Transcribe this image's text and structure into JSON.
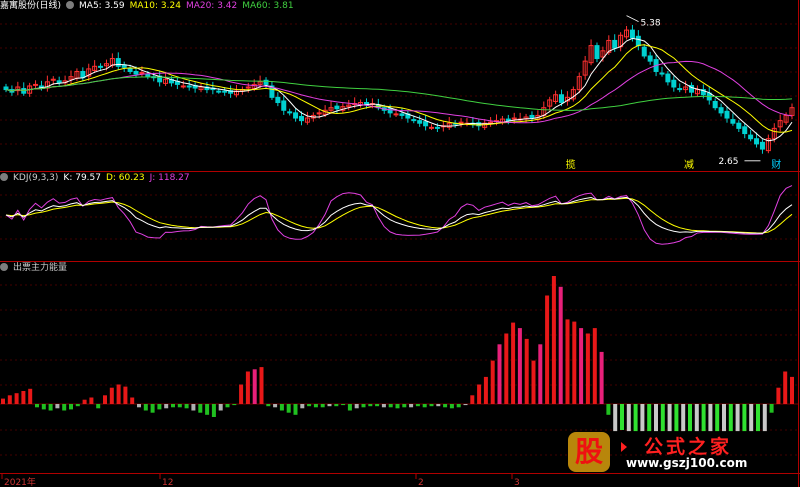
{
  "header_main": {
    "title": "嘉寓股份(日线)",
    "ma": [
      {
        "label": "MA5: 3.59",
        "color": "#ffffff"
      },
      {
        "label": "MA10: 3.24",
        "color": "#ffff00"
      },
      {
        "label": "MA20: 3.42",
        "color": "#e040e0"
      },
      {
        "label": "MA60: 3.81",
        "color": "#40d040"
      }
    ]
  },
  "header_kdj": {
    "title": "KDJ(9,3,3)",
    "items": [
      {
        "label": "K: 79.57",
        "color": "#ffffff"
      },
      {
        "label": "D: 60.23",
        "color": "#ffff00"
      },
      {
        "label": "J: 118.27",
        "color": "#e040e0"
      }
    ]
  },
  "header_ind": {
    "title": "出票主力能量"
  },
  "annotations": {
    "high": "5.38",
    "low": "2.65",
    "marker1": "揽",
    "marker2": "减",
    "marker3": "财"
  },
  "date_labels": [
    "2021年",
    "12",
    "2",
    "3"
  ],
  "watermark": {
    "logo": "股",
    "title": "公式之家",
    "url": "www.gszj100.com"
  },
  "colors": {
    "up": "#ff3030",
    "down": "#00d0d0",
    "ma5": "#ffffff",
    "ma10": "#ffff00",
    "ma20": "#e040e0",
    "ma60": "#40d040",
    "grid": "#8a0000"
  },
  "chart_data": [
    {
      "type": "candlestick",
      "title": "嘉寓股份(日线)",
      "ylim": [
        2.55,
        5.45
      ],
      "annotations": {
        "max": 5.38,
        "min": 2.65
      },
      "closes": [
        3.95,
        3.9,
        4.0,
        3.88,
        4.02,
        4.05,
        3.98,
        4.1,
        4.15,
        4.08,
        4.12,
        4.2,
        4.3,
        4.18,
        4.35,
        4.4,
        4.38,
        4.45,
        4.55,
        4.4,
        4.38,
        4.3,
        4.25,
        4.28,
        4.2,
        4.18,
        4.1,
        4.15,
        4.08,
        4.05,
        4.02,
        4.0,
        3.98,
        4.0,
        3.95,
        3.95,
        3.92,
        3.9,
        3.88,
        3.92,
        3.95,
        4.0,
        4.05,
        4.1,
        4.05,
        3.8,
        3.7,
        3.55,
        3.5,
        3.4,
        3.35,
        3.4,
        3.45,
        3.5,
        3.55,
        3.6,
        3.58,
        3.62,
        3.65,
        3.68,
        3.7,
        3.65,
        3.68,
        3.6,
        3.55,
        3.5,
        3.48,
        3.45,
        3.4,
        3.35,
        3.3,
        3.25,
        3.22,
        3.2,
        3.25,
        3.3,
        3.28,
        3.32,
        3.3,
        3.28,
        3.25,
        3.3,
        3.32,
        3.35,
        3.38,
        3.35,
        3.4,
        3.38,
        3.42,
        3.4,
        3.45,
        3.6,
        3.75,
        3.85,
        3.7,
        3.8,
        3.95,
        4.2,
        4.5,
        4.8,
        4.55,
        4.7,
        4.9,
        4.75,
        5.0,
        5.1,
        4.95,
        4.8,
        4.6,
        4.5,
        4.3,
        4.25,
        4.1,
        4.0,
        3.95,
        4.0,
        3.9,
        3.95,
        3.85,
        3.75,
        3.6,
        3.5,
        3.4,
        3.3,
        3.2,
        3.1,
        3.0,
        2.9,
        2.8,
        3.0,
        3.2,
        3.35,
        3.45,
        3.6
      ],
      "kdj": {
        "K": 79.57,
        "D": 60.23,
        "J": 118.27
      },
      "indicator": {
        "name": "出票主力能量",
        "values": [
          5,
          8,
          10,
          12,
          14,
          -3,
          -5,
          -6,
          -4,
          -6,
          -5,
          -2,
          4,
          6,
          -4,
          8,
          15,
          18,
          16,
          6,
          -3,
          -6,
          -8,
          -5,
          -4,
          -3,
          -3,
          -4,
          -6,
          -8,
          -10,
          -12,
          -6,
          -3,
          -1,
          18,
          30,
          32,
          34,
          -2,
          -3,
          -6,
          -8,
          -10,
          -4,
          -2,
          -3,
          -3,
          -2,
          -2,
          -1,
          -6,
          -4,
          -3,
          -2,
          -2,
          -3,
          -3,
          -4,
          -3,
          -3,
          -2,
          -3,
          -2,
          -2,
          -3,
          -4,
          -3,
          -1,
          8,
          18,
          25,
          40,
          55,
          65,
          75,
          70,
          60,
          40,
          55,
          100,
          118,
          108,
          78,
          76,
          70,
          65,
          70,
          48,
          -10,
          -25,
          -24,
          -25,
          -25,
          -25,
          -25,
          -25,
          -25,
          -25,
          -25,
          -25,
          -25,
          -25,
          -25,
          -25,
          -25,
          -25,
          -25,
          -25,
          -25,
          -25,
          -25,
          -25,
          -8,
          15,
          30,
          25
        ]
      }
    }
  ]
}
